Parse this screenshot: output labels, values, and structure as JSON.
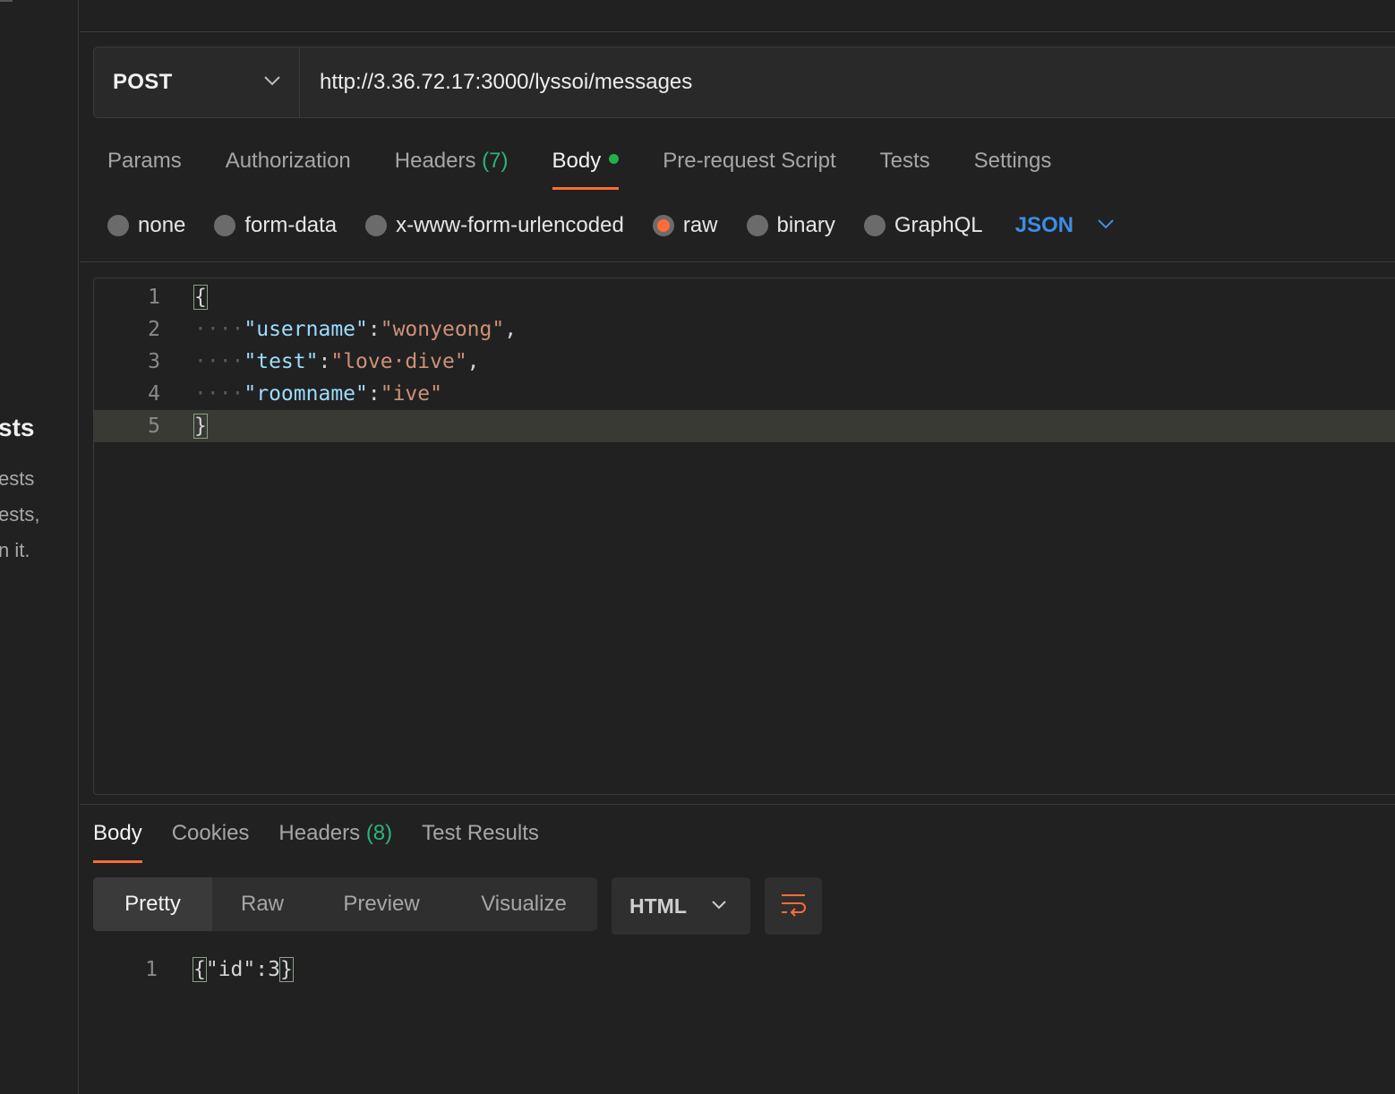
{
  "sidebar": {
    "heading": "sts",
    "lines": [
      "ests",
      "ests,",
      "n it."
    ]
  },
  "request": {
    "method": "POST",
    "url": "http://3.36.72.17:3000/lyssoi/messages"
  },
  "request_tabs": [
    {
      "label": "Params"
    },
    {
      "label": "Authorization"
    },
    {
      "label": "Headers",
      "count": "(7)"
    },
    {
      "label": "Body",
      "active": true
    },
    {
      "label": "Pre-request Script"
    },
    {
      "label": "Tests"
    },
    {
      "label": "Settings"
    }
  ],
  "body_types": {
    "options": [
      "none",
      "form-data",
      "x-www-form-urlencoded",
      "raw",
      "binary",
      "GraphQL"
    ],
    "selected": "raw",
    "language": "JSON"
  },
  "editor": {
    "line_numbers": [
      "1",
      "2",
      "3",
      "4",
      "5"
    ],
    "open_brace": "{",
    "close_brace": "}",
    "indent": "····",
    "lines": [
      {
        "key": "\"username\"",
        "sep": ":",
        "value": "\"wonyeong\"",
        "end": ","
      },
      {
        "key": "\"test\"",
        "sep": ":",
        "value": "\"love·dive\"",
        "end": ","
      },
      {
        "key": "\"roomname\"",
        "sep": ":",
        "value": "\"ive\"",
        "end": ""
      }
    ]
  },
  "response_tabs": [
    {
      "label": "Body",
      "active": true
    },
    {
      "label": "Cookies"
    },
    {
      "label": "Headers",
      "count": "(8)"
    },
    {
      "label": "Test Results"
    }
  ],
  "response_view": {
    "modes": [
      "Pretty",
      "Raw",
      "Preview",
      "Visualize"
    ],
    "selected": "Pretty",
    "format": "HTML"
  },
  "response_body": {
    "line_number": "1",
    "open_brace": "{",
    "content": "\"id\":3",
    "close_brace": "}"
  },
  "colors": {
    "accent": "#ff6c37",
    "body_dot": "#21b14a",
    "count": "#2fb37a",
    "language": "#3d8ce8"
  }
}
